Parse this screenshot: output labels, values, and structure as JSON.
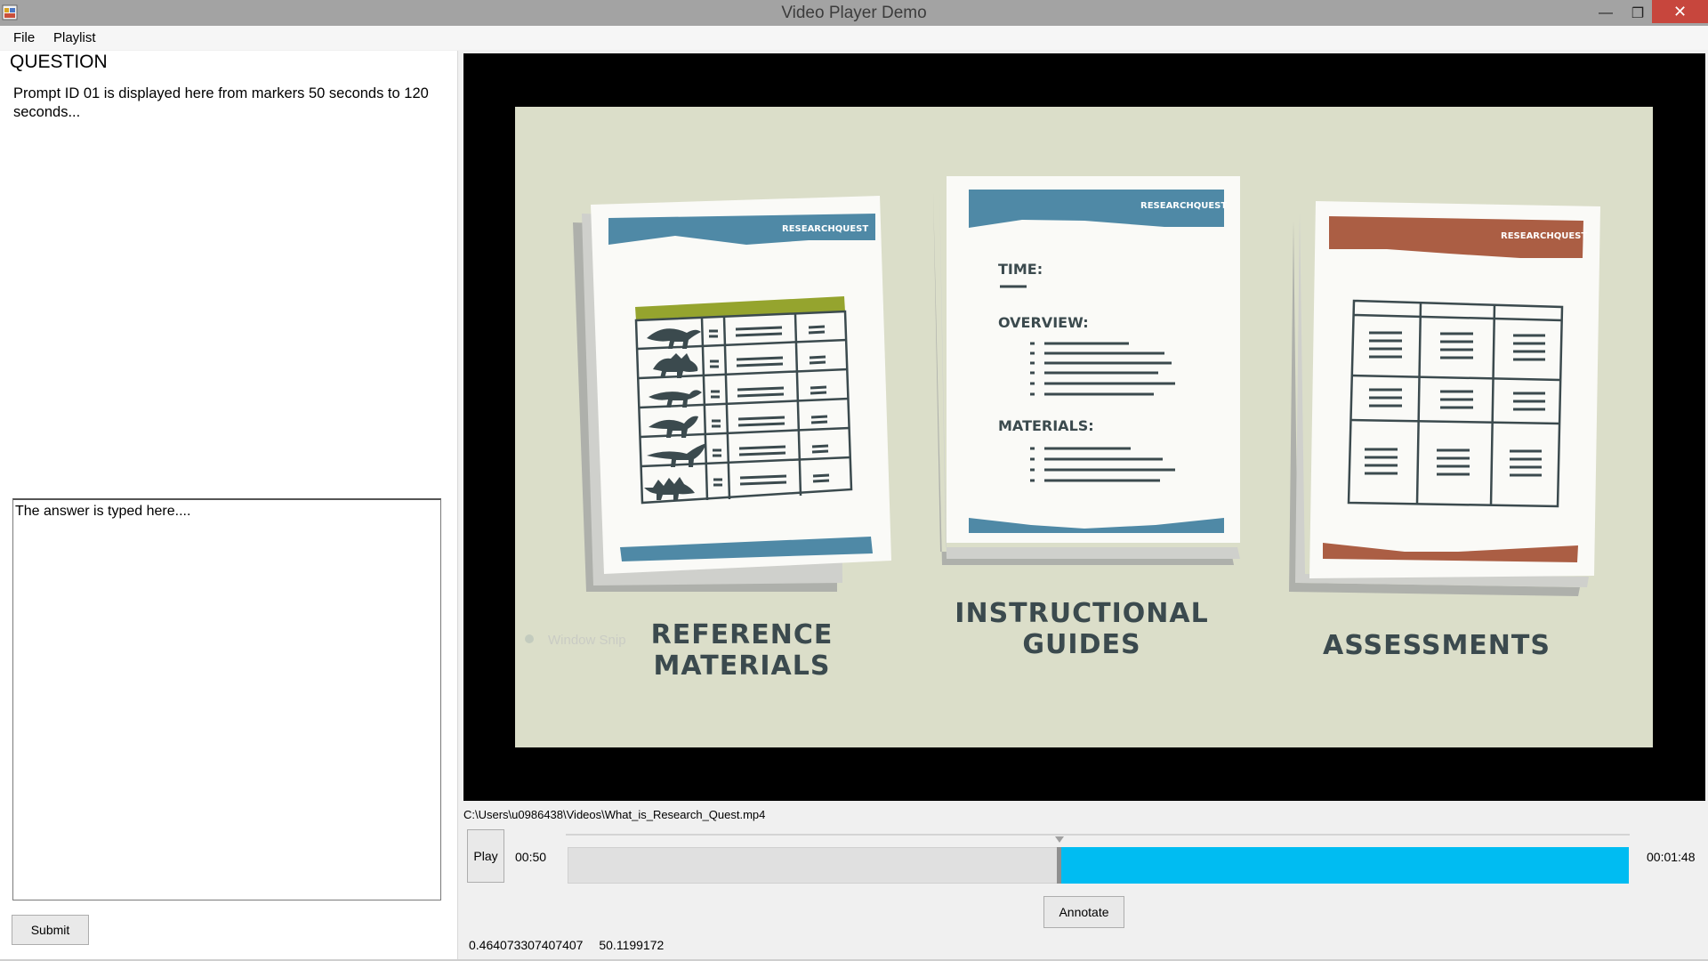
{
  "window": {
    "title": "Video Player Demo",
    "minimize_glyph": "—",
    "maximize_glyph": "❐",
    "close_glyph": "✕"
  },
  "menu": {
    "file": "File",
    "playlist": "Playlist"
  },
  "left_pane": {
    "heading": "QUESTION",
    "prompt": "Prompt ID 01 is displayed here from markers 50 seconds to 120 seconds...",
    "answer_value": "The answer is typed here....",
    "submit_label": "Submit"
  },
  "video": {
    "brand": "RESEARCHQUEST",
    "doc1": {
      "caption_line1": "REFERENCE",
      "caption_line2": "MATERIALS"
    },
    "doc2": {
      "caption_line1": "INSTRUCTIONAL",
      "caption_line2": "GUIDES",
      "time_label": "TIME:",
      "overview_label": "OVERVIEW:",
      "materials_label": "MATERIALS:"
    },
    "doc3": {
      "caption_line1": "ASSESSMENTS"
    },
    "overlay_text": "Window Snip"
  },
  "player": {
    "file_path": "C:\\Users\\u0986438\\Videos\\What_is_Research_Quest.mp4",
    "play_label": "Play",
    "current_time": "00:50",
    "total_time": "00:01:48",
    "progress_fraction": 0.463,
    "annotate_label": "Annotate",
    "readout_ratio": "0.464073307407407",
    "readout_seconds": "50.1199172"
  },
  "colors": {
    "progress_fill": "#00bcf2",
    "blue_header": "#4f89a6",
    "rust_header": "#ab5e44",
    "green_header": "#95a42e",
    "close_button": "#c7463d"
  },
  "icons": [
    "app-icon",
    "minimize-icon",
    "maximize-icon",
    "close-icon",
    "dinosaur-icon"
  ]
}
